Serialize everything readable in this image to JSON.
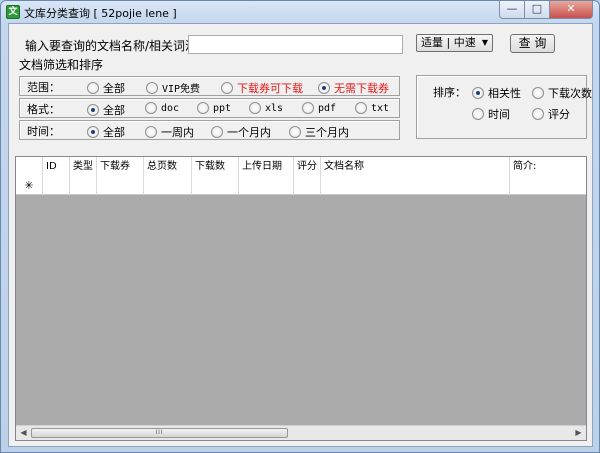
{
  "window": {
    "title": "文库分类查询 [ 52pojie lene ]",
    "icon_glyph": "文",
    "minimize_glyph": "—",
    "maximize_glyph": "□",
    "close_glyph": "✕"
  },
  "search": {
    "prompt_label": "输入要查询的文档名称/相关词汇：",
    "query_value": "",
    "speed_selected": "适量 | 中速",
    "query_button": "查 询"
  },
  "filters": {
    "section_title": "文档筛选和排序",
    "scope": {
      "label": "范围：",
      "options": [
        {
          "label": "全部",
          "selected": false
        },
        {
          "label": "VIP免费",
          "selected": false
        },
        {
          "label": "下载券可下载",
          "selected": false
        },
        {
          "label": "无需下载券",
          "selected": true
        }
      ]
    },
    "format": {
      "label": "格式：",
      "options": [
        {
          "label": "全部",
          "selected": true
        },
        {
          "label": "doc",
          "selected": false
        },
        {
          "label": "ppt",
          "selected": false
        },
        {
          "label": "xls",
          "selected": false
        },
        {
          "label": "pdf",
          "selected": false
        },
        {
          "label": "txt",
          "selected": false
        }
      ]
    },
    "time": {
      "label": "时间：",
      "options": [
        {
          "label": "全部",
          "selected": true
        },
        {
          "label": "一周内",
          "selected": false
        },
        {
          "label": "一个月内",
          "selected": false
        },
        {
          "label": "三个月内",
          "selected": false
        }
      ]
    }
  },
  "sort": {
    "label": "排序：",
    "options": [
      {
        "label": "相关性",
        "selected": true
      },
      {
        "label": "下载次数",
        "selected": false
      },
      {
        "label": "时间",
        "selected": false
      },
      {
        "label": "评分",
        "selected": false
      }
    ]
  },
  "table": {
    "columns": [
      "ID",
      "类型",
      "下载券",
      "总页数",
      "下载数",
      "上传日期",
      "评分",
      "文档名称",
      "简介:"
    ],
    "new_row_marker": "✳",
    "rows": []
  },
  "scrollbar": {
    "left_arrow": "◀",
    "right_arrow": "▶",
    "thumb_grip": "III"
  },
  "colors": {
    "accent_red": "#e01b1b",
    "grid_background": "#ababab",
    "window_frame": "#bcd0e8"
  }
}
